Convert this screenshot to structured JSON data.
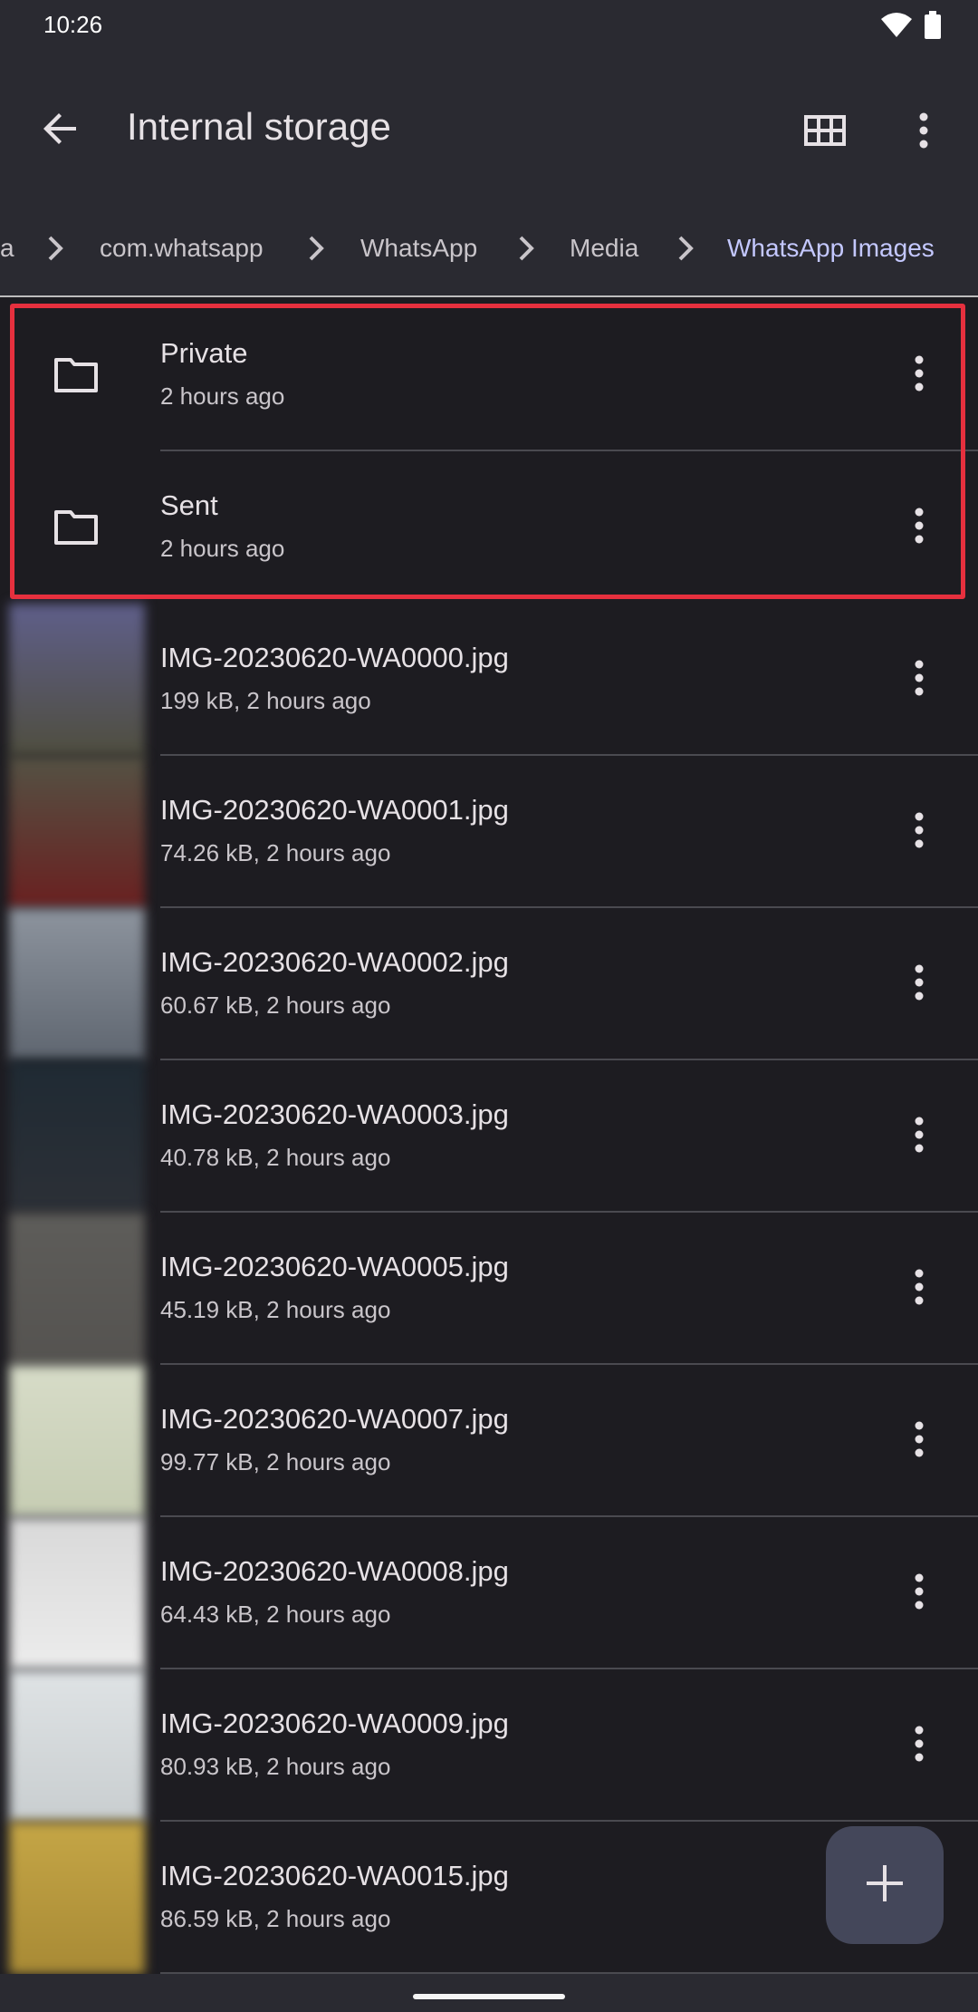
{
  "status_bar": {
    "time": "10:26"
  },
  "app_bar": {
    "title": "Internal storage"
  },
  "breadcrumb": {
    "items": [
      "a",
      "com.whatsapp",
      "WhatsApp",
      "Media",
      "WhatsApp Images"
    ]
  },
  "rows": [
    {
      "type": "folder",
      "title": "Private",
      "subtitle": "2 hours ago"
    },
    {
      "type": "folder",
      "title": "Sent",
      "subtitle": "2 hours ago"
    },
    {
      "type": "image",
      "title": "IMG-20230620-WA0000.jpg",
      "subtitle": "199 kB, 2 hours ago",
      "thumb_colors": [
        "#5f5f8a",
        "#4f4e3f"
      ]
    },
    {
      "type": "image",
      "title": "IMG-20230620-WA0001.jpg",
      "subtitle": "74.26 kB, 2 hours ago",
      "thumb_colors": [
        "#545244",
        "#6a2020"
      ]
    },
    {
      "type": "image",
      "title": "IMG-20230620-WA0002.jpg",
      "subtitle": "60.67 kB, 2 hours ago",
      "thumb_colors": [
        "#8d949e",
        "#5f6670"
      ]
    },
    {
      "type": "image",
      "title": "IMG-20230620-WA0003.jpg",
      "subtitle": "40.78 kB, 2 hours ago",
      "thumb_colors": [
        "#1f2a33",
        "#2c3037"
      ]
    },
    {
      "type": "image",
      "title": "IMG-20230620-WA0005.jpg",
      "subtitle": "45.19 kB, 2 hours ago",
      "thumb_colors": [
        "#5e5d5a",
        "#555350"
      ]
    },
    {
      "type": "image",
      "title": "IMG-20230620-WA0007.jpg",
      "subtitle": "99.77 kB, 2 hours ago",
      "thumb_colors": [
        "#d7dcc8",
        "#c6cdb3"
      ]
    },
    {
      "type": "image",
      "title": "IMG-20230620-WA0008.jpg",
      "subtitle": "64.43 kB, 2 hours ago",
      "thumb_colors": [
        "#d9d9d9",
        "#ececec"
      ]
    },
    {
      "type": "image",
      "title": "IMG-20230620-WA0009.jpg",
      "subtitle": "80.93 kB, 2 hours ago",
      "thumb_colors": [
        "#dfe3e5",
        "#c9ced0"
      ]
    },
    {
      "type": "image",
      "title": "IMG-20230620-WA0015.jpg",
      "subtitle": "86.59 kB, 2 hours ago",
      "thumb_colors": [
        "#c5a646",
        "#a88a35"
      ]
    }
  ],
  "colors": {
    "background": "#1d1c21",
    "app_bar": "#2a2a31",
    "accent": "#c4c8ff",
    "highlight": "#e6303e",
    "fab": "#44475a"
  },
  "icons": {
    "back": "arrow-left-icon",
    "grid": "grid-view-icon",
    "more": "more-vert-icon",
    "folder": "folder-icon",
    "add": "add-icon"
  }
}
